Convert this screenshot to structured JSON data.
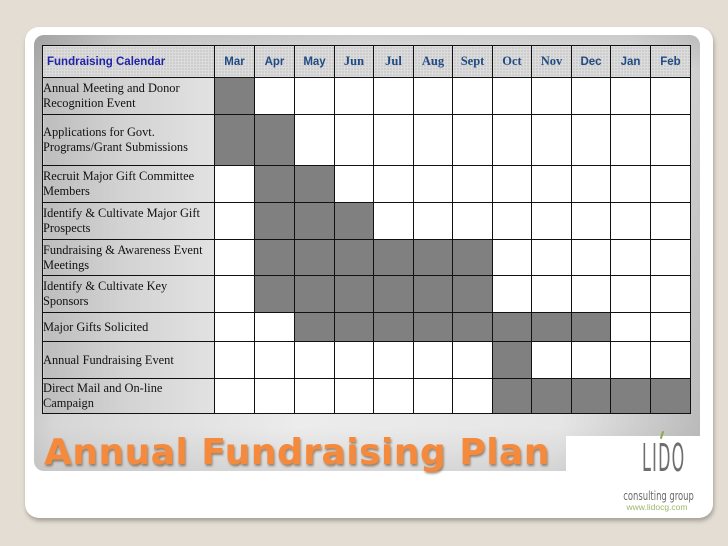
{
  "slide": {
    "title": "Annual Fundraising Plan"
  },
  "calendar": {
    "corner_label": "Fundraising Calendar",
    "months": [
      "Mar",
      "Apr",
      "May",
      "Jun",
      "Jul",
      "Aug",
      "Sept",
      "Oct",
      "Nov",
      "Dec",
      "Jan",
      "Feb"
    ],
    "active_color": "#808080",
    "rows": [
      {
        "task": "Annual Meeting and Donor Recognition Event",
        "active": [
          "Mar"
        ]
      },
      {
        "task": "Applications for Govt. Programs/Grant Submissions",
        "active": [
          "Mar",
          "Apr"
        ]
      },
      {
        "task": "Recruit Major Gift Committee Members",
        "active": [
          "Apr",
          "May"
        ]
      },
      {
        "task": "Identify & Cultivate Major Gift Prospects",
        "active": [
          "Apr",
          "May",
          "Jun"
        ]
      },
      {
        "task": "Fundraising & Awareness Event Meetings",
        "active": [
          "Apr",
          "May",
          "Jun",
          "Jul",
          "Aug",
          "Sept"
        ]
      },
      {
        "task": "Identify & Cultivate Key Sponsors",
        "active": [
          "Apr",
          "May",
          "Jun",
          "Jul",
          "Aug",
          "Sept"
        ]
      },
      {
        "task": "Major Gifts Solicited",
        "active": [
          "May",
          "Jun",
          "Jul",
          "Aug",
          "Sept",
          "Oct",
          "Nov",
          "Dec"
        ]
      },
      {
        "task": "Annual Fundraising Event",
        "active": [
          "Oct"
        ]
      },
      {
        "task": "Direct Mail and On-line Campaign",
        "active": [
          "Oct",
          "Nov",
          "Dec",
          "Jan",
          "Feb"
        ]
      }
    ]
  },
  "logo": {
    "name": "LIDO",
    "tagline": "consulting group",
    "url": "www.lidocg.com"
  },
  "colors": {
    "title": "#f5893c",
    "header_text": "#1f4a84",
    "corner_text": "#1e23a8",
    "background": "#e4ddd3"
  }
}
